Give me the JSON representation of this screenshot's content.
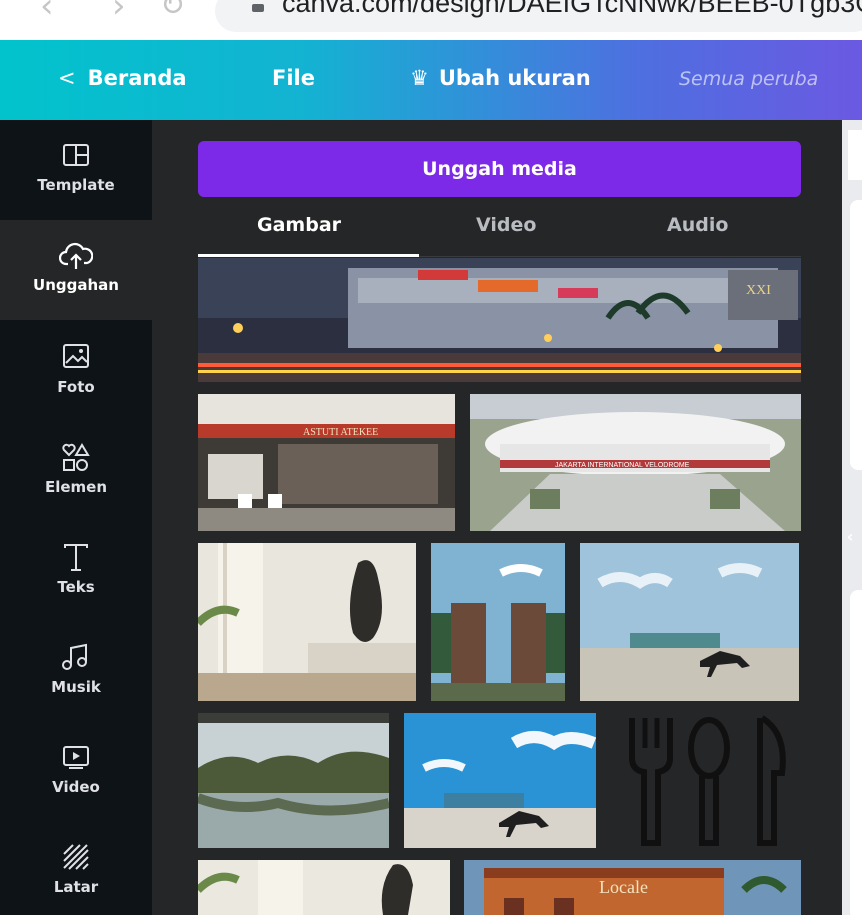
{
  "browser": {
    "url": "canva.com/design/DAEIGTcNNwk/BEEB-0Tgb3G"
  },
  "topbar": {
    "back_label": "Beranda",
    "file_label": "File",
    "resize_label": "Ubah ukuran",
    "status_text": "Semua peruba"
  },
  "sidebar": {
    "items": [
      {
        "label": "Template",
        "icon": "template-icon"
      },
      {
        "label": "Unggahan",
        "icon": "cloud-upload-icon"
      },
      {
        "label": "Foto",
        "icon": "photo-icon"
      },
      {
        "label": "Elemen",
        "icon": "elements-icon"
      },
      {
        "label": "Teks",
        "icon": "text-icon"
      },
      {
        "label": "Musik",
        "icon": "music-icon"
      },
      {
        "label": "Video",
        "icon": "video-icon"
      },
      {
        "label": "Latar",
        "icon": "background-icon"
      }
    ]
  },
  "panel": {
    "upload_button": "Unggah media",
    "tabs": [
      {
        "label": "Gambar",
        "active": true
      },
      {
        "label": "Video",
        "active": false
      },
      {
        "label": "Audio",
        "active": false
      }
    ],
    "images": [
      {
        "name": "mall-night"
      },
      {
        "name": "storefront"
      },
      {
        "name": "velodrome-aerial"
      },
      {
        "name": "statue-interior"
      },
      {
        "name": "temple-gate"
      },
      {
        "name": "horse-statue-field"
      },
      {
        "name": "lake-trees"
      },
      {
        "name": "horse-statue-sky"
      },
      {
        "name": "cutlery-icon-image"
      },
      {
        "name": "statue-interior-2"
      },
      {
        "name": "building-facade"
      }
    ],
    "thumb_texts": {
      "storefront_sign": "ASTUTI ATEKEE",
      "velodrome_sign": "JAKARTA INTERNATIONAL VELODROME",
      "building_sign": "Locale",
      "cinema_sign": "XXI"
    }
  }
}
